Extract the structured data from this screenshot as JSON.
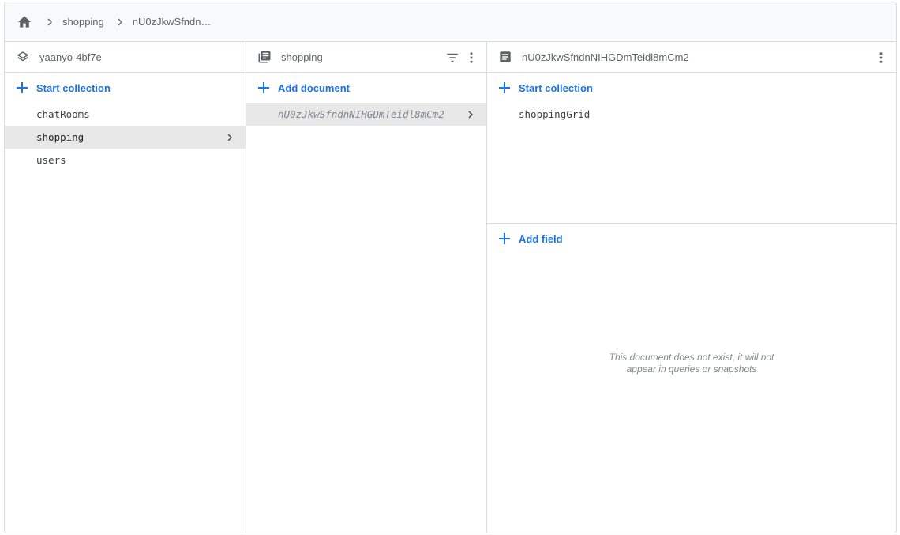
{
  "breadcrumb": {
    "home_icon": "home-icon",
    "items": [
      "shopping",
      "nU0zJkwSfndn…"
    ]
  },
  "col1": {
    "header_icon": "firestore-project-icon",
    "title": "yaanyo-4bf7e",
    "add_label": "Start collection",
    "items": [
      "chatRooms",
      "shopping",
      "users"
    ],
    "selected_index": 1
  },
  "col2": {
    "header_icon": "collection-icon",
    "title": "shopping",
    "add_label": "Add document",
    "items": [
      "nU0zJkwSfndnNIHGDmTeidl8mCm2"
    ]
  },
  "col3": {
    "header_icon": "document-icon",
    "title": "nU0zJkwSfndnNIHGDmTeidl8mCm2",
    "add_collection_label": "Start collection",
    "subcollections": [
      "shoppingGrid"
    ],
    "add_field_label": "Add field",
    "empty_line1": "This document does not exist, it will not",
    "empty_line2": "appear in queries or snapshots"
  },
  "colors": {
    "accent": "#1a73e8",
    "border": "#dadce0",
    "selected_bg": "#e8e8e8",
    "muted_text": "#5f6368"
  }
}
